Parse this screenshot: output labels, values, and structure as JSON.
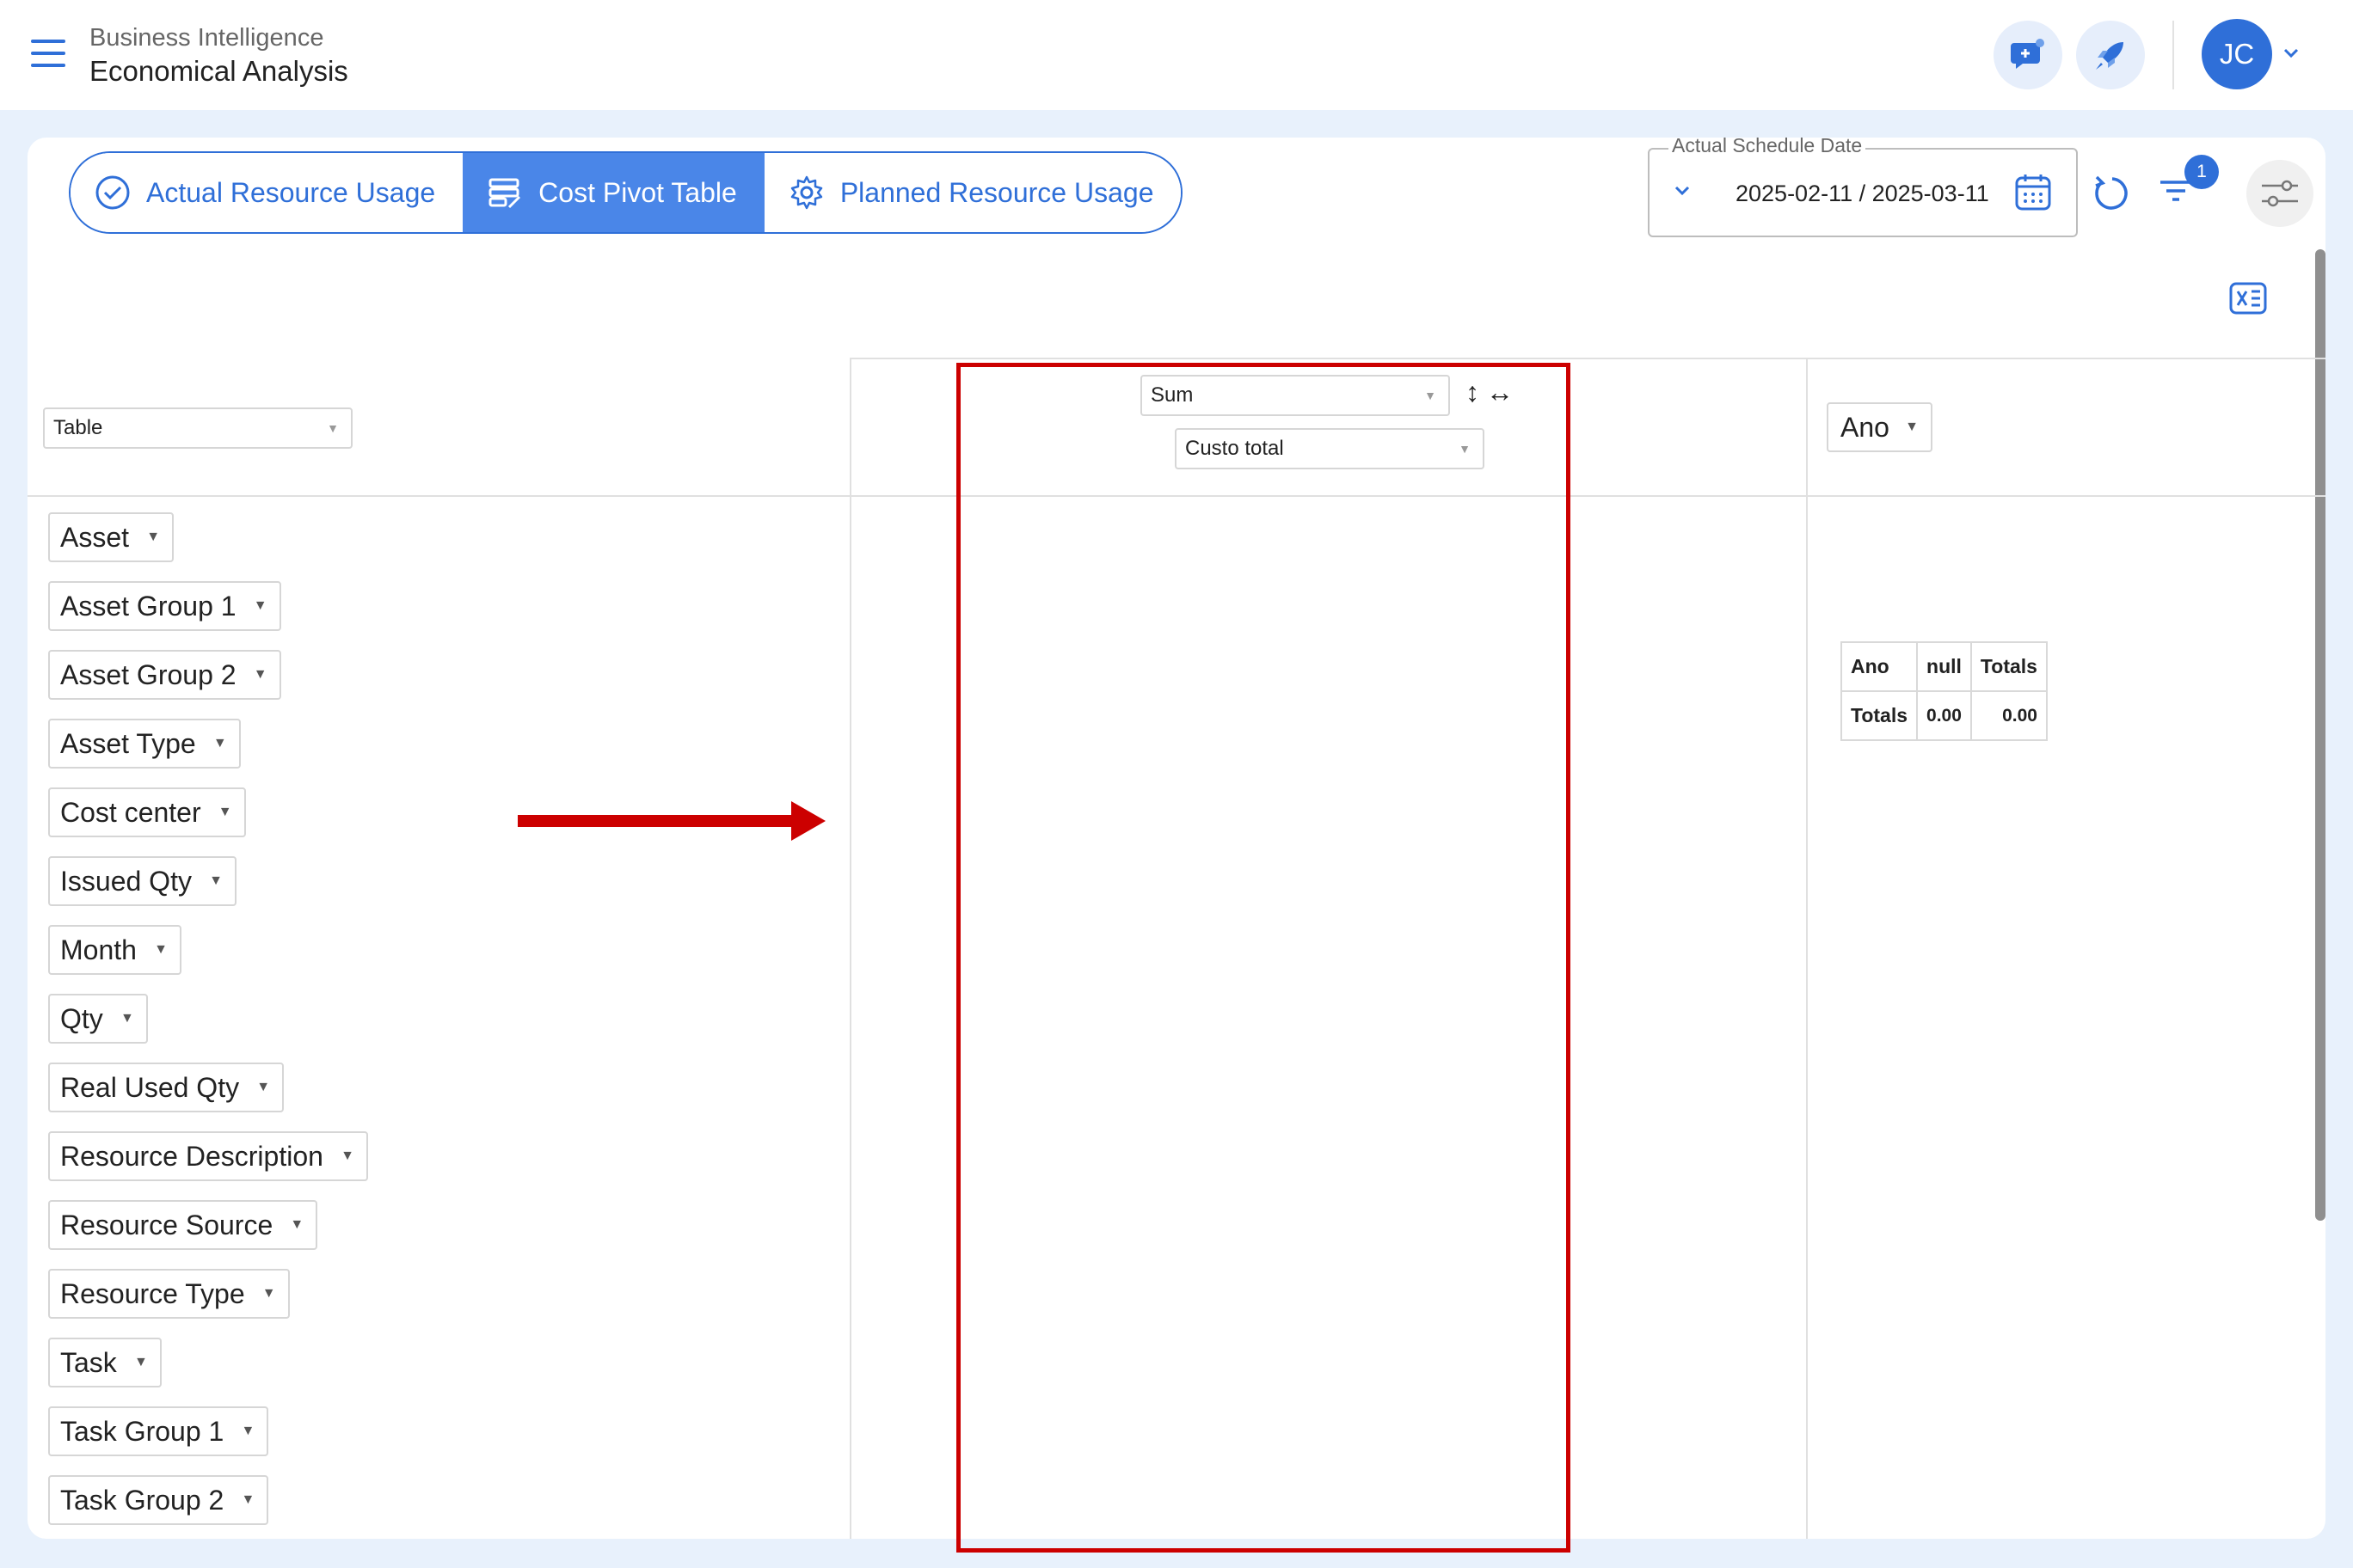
{
  "header": {
    "section": "Business Intelligence",
    "title": "Economical Analysis",
    "user_initials": "JC"
  },
  "tabs": [
    {
      "label": "Actual Resource Usage",
      "active": false
    },
    {
      "label": "Cost Pivot Table",
      "active": true
    },
    {
      "label": "Planned Resource Usage",
      "active": false
    }
  ],
  "date_filter": {
    "label": "Actual Schedule Date",
    "value": "2025-02-11 / 2025-03-11"
  },
  "filter_badge": "1",
  "pivot": {
    "renderer": "Table",
    "aggregator": "Sum",
    "aggregator_field": "Custo total",
    "column_attr": "Ano",
    "attributes": [
      "Asset",
      "Asset Group 1",
      "Asset Group 2",
      "Asset Type",
      "Cost center",
      "Issued Qty",
      "Month",
      "Qty",
      "Real Used Qty",
      "Resource Description",
      "Resource Source",
      "Resource Type",
      "Task",
      "Task Group 1",
      "Task Group 2"
    ],
    "table": {
      "header": [
        "Ano",
        "null",
        "Totals"
      ],
      "row": [
        "Totals",
        "0.00",
        "0.00"
      ]
    }
  },
  "colors": {
    "accent": "#2f6fd8",
    "active_tab": "#4a86e8",
    "highlight": "#cc0000",
    "background": "#e8f1fc"
  },
  "icons": [
    "menu-icon",
    "chat-add-icon",
    "rocket-icon",
    "chevron-down-icon",
    "check-circle-icon",
    "table-edit-icon",
    "gear-icon",
    "calendar-icon",
    "refresh-icon",
    "filter-icon",
    "sliders-icon",
    "excel-export-icon",
    "sort-vertical-icon",
    "sort-horizontal-icon",
    "arrow-right-icon"
  ]
}
